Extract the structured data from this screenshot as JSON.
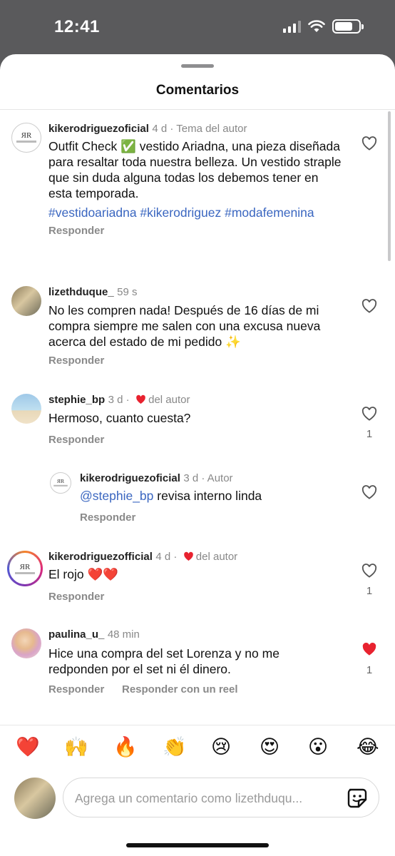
{
  "status_bar": {
    "time": "12:41",
    "battery_level": 0.75
  },
  "sheet": {
    "title": "Comentarios"
  },
  "comments": [
    {
      "username": "kikerodriguezoficial",
      "meta": "4 d · Tema del autor",
      "text": "Outfit Check ✅ vestido Ariadna, una pieza diseñada para resaltar toda nuestra belleza. Un vestido straple que sin duda alguna todas los debemos tener en esta temporada.",
      "hashtags": "#vestidoariadna #kikerodriguez #modafemenina",
      "reply_label": "Responder"
    },
    {
      "username": "lizethduque_",
      "meta": "59 s",
      "text": "No les compren nada! Después de 16 días de mi compra siempre me salen con una excusa nueva acerca del estado de mi pedido ✨",
      "reply_label": "Responder"
    },
    {
      "username": "stephie_bp",
      "meta": "3 d ·",
      "author_like": "del autor",
      "text": "Hermoso, cuanto cuesta?",
      "reply_label": "Responder",
      "likes": "1"
    },
    {
      "username": "kikerodriguezoficial",
      "meta": "3 d · Autor",
      "mention": "@stephie_bp",
      "text": " revisa interno linda",
      "reply_label": "Responder"
    },
    {
      "username": "kikerodriguezofficial",
      "meta": "4 d ·",
      "author_like": "del autor",
      "text": "El rojo ❤️❤️",
      "reply_label": "Responder",
      "likes": "1"
    },
    {
      "username": "paulina_u_",
      "meta": "48 min",
      "text": "Hice una compra del set Lorenza y no me redponden por el set ni él dinero.",
      "reply_label": "Responder",
      "reel_label": "Responder con un reel",
      "likes": "1",
      "liked": true
    }
  ],
  "emoji_bar": [
    "❤️",
    "🙌",
    "🔥",
    "👏",
    "😢",
    "😍",
    "😮",
    "😂"
  ],
  "comment_input": {
    "placeholder": "Agrega un comentario como lizethduqu..."
  },
  "icons": {
    "heart": "heart-icon",
    "heart_filled": "heart-filled-icon",
    "sticker": "sticker-icon",
    "logo": "kr-logo"
  },
  "colors": {
    "link": "#3a66c0",
    "like_red": "#e8222f",
    "muted": "#8a8a8a"
  }
}
